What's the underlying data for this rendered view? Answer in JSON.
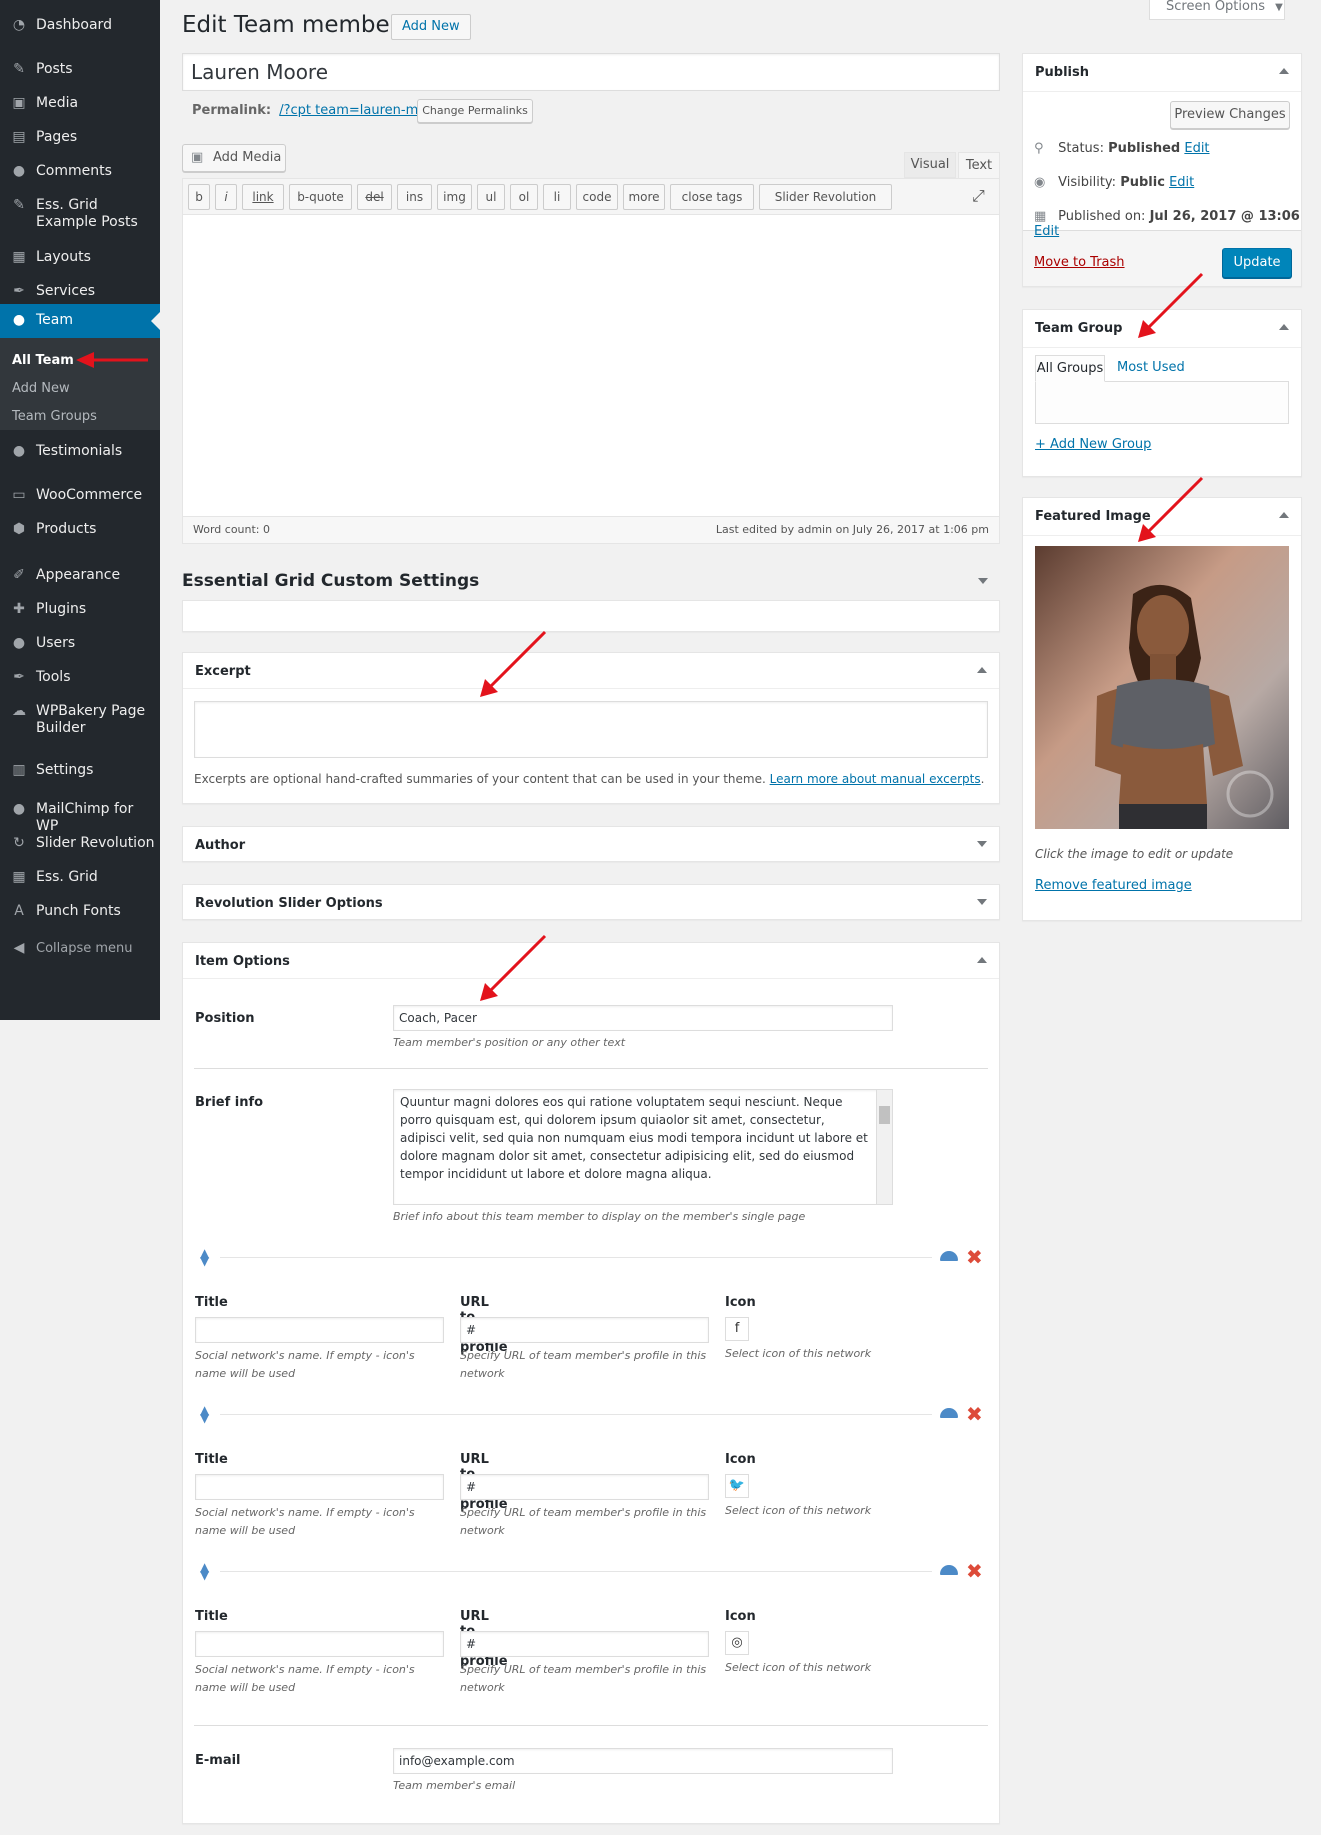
{
  "menu": {
    "items": [
      {
        "label": "Dashboard",
        "icon": "dashboard-icon",
        "glyph": "◔"
      },
      {
        "label": "Posts",
        "icon": "pin-icon",
        "glyph": "✎"
      },
      {
        "label": "Media",
        "icon": "media-icon",
        "glyph": "▣"
      },
      {
        "label": "Pages",
        "icon": "pages-icon",
        "glyph": "▤"
      },
      {
        "label": "Comments",
        "icon": "comments-icon",
        "glyph": "●"
      },
      {
        "label": "Ess. Grid Example Posts",
        "icon": "pin-icon",
        "glyph": "✎"
      },
      {
        "label": "Layouts",
        "icon": "layouts-icon",
        "glyph": "▦"
      },
      {
        "label": "Services",
        "icon": "wrench-icon",
        "glyph": "✒"
      },
      {
        "label": "Team",
        "icon": "user-icon",
        "glyph": "●"
      },
      {
        "label": "Testimonials",
        "icon": "testimonials-icon",
        "glyph": "●"
      },
      {
        "label": "WooCommerce",
        "icon": "woocommerce-icon",
        "glyph": "▭"
      },
      {
        "label": "Products",
        "icon": "products-icon",
        "glyph": "⬢"
      },
      {
        "label": "Appearance",
        "icon": "brush-icon",
        "glyph": "✐"
      },
      {
        "label": "Plugins",
        "icon": "plugin-icon",
        "glyph": "✚"
      },
      {
        "label": "Users",
        "icon": "users-icon",
        "glyph": "●"
      },
      {
        "label": "Tools",
        "icon": "tools-icon",
        "glyph": "✒"
      },
      {
        "label": "WPBakery Page Builder",
        "icon": "wpbakery-icon",
        "glyph": "☁"
      },
      {
        "label": "Settings",
        "icon": "settings-icon",
        "glyph": "▥"
      },
      {
        "label": "MailChimp for WP",
        "icon": "mailchimp-icon",
        "glyph": "●"
      },
      {
        "label": "Slider Revolution",
        "icon": "refresh-icon",
        "glyph": "↻"
      },
      {
        "label": "Ess. Grid",
        "icon": "grid-icon",
        "glyph": "▦"
      },
      {
        "label": "Punch Fonts",
        "icon": "font-icon",
        "glyph": "A"
      }
    ],
    "submenu": [
      "All Team",
      "Add New",
      "Team Groups"
    ],
    "collapse": "Collapse menu"
  },
  "header": {
    "title": "Edit Team member",
    "add_new": "Add New",
    "screen_options": "Screen Options"
  },
  "post": {
    "title": "Lauren Moore",
    "permalink_label": "Permalink:",
    "permalink_url": "/?cpt team=lauren-moore",
    "change_permalinks": "Change Permalinks"
  },
  "editor": {
    "add_media": "Add Media",
    "tab_visual": "Visual",
    "tab_text": "Text",
    "quicktags": [
      "b",
      "i",
      "link",
      "b-quote",
      "del",
      "ins",
      "img",
      "ul",
      "ol",
      "li",
      "code",
      "more",
      "close tags",
      "Slider Revolution"
    ],
    "word_count": "Word count: 0",
    "last_edited": "Last edited by admin on July 26, 2017 at 1:06 pm"
  },
  "ess_grid": {
    "title": "Essential Grid Custom Settings"
  },
  "excerpt": {
    "title": "Excerpt",
    "help": "Excerpts are optional hand-crafted summaries of your content that can be used in your theme.",
    "learn_more": "Learn more about manual excerpts",
    "period": "."
  },
  "author": {
    "title": "Author"
  },
  "rev_slider": {
    "title": "Revolution Slider Options"
  },
  "item_options": {
    "title": "Item Options",
    "position_label": "Position",
    "position_value": "Coach, Pacer",
    "position_desc": "Team member's position or any other text",
    "brief_label": "Brief info",
    "brief_value": "Quuntur magni dolores eos qui ratione voluptatem sequi nesciunt. Neque porro quisquam est, qui dolorem ipsum quiaolor sit amet, consectetur, adipisci velit, sed quia non numquam eius modi tempora incidunt ut labore et dolore magnam dolor sit amet, consectetur adipisicing elit, sed do eiusmod tempor incididunt ut labore et dolore magna aliqua.",
    "brief_desc": "Brief info about this team member to display on the member's single page",
    "social": [
      {
        "title_label": "Title",
        "title_value": "",
        "url_label": "URL to your profile",
        "url_value": "#",
        "icon_label": "Icon",
        "icon": "facebook-icon",
        "glyph": "f",
        "title_desc": "Social network's name. If empty - icon's name will be used",
        "url_desc": "Specify URL of team member's profile in this network",
        "icon_desc": "Select icon of this network"
      },
      {
        "title_label": "Title",
        "title_value": "",
        "url_label": "URL to your profile",
        "url_value": "#",
        "icon_label": "Icon",
        "icon": "twitter-icon",
        "glyph": "🐦",
        "title_desc": "Social network's name. If empty - icon's name will be used",
        "url_desc": "Specify URL of team member's profile in this network",
        "icon_desc": "Select icon of this network"
      },
      {
        "title_label": "Title",
        "title_value": "",
        "url_label": "URL to your profile",
        "url_value": "#",
        "icon_label": "Icon",
        "icon": "instagram-icon",
        "glyph": "◎",
        "title_desc": "Social network's name. If empty - icon's name will be used",
        "url_desc": "Specify URL of team member's profile in this network",
        "icon_desc": "Select icon of this network"
      }
    ],
    "email_label": "E-mail",
    "email_value": "info@example.com",
    "email_desc": "Team member's email"
  },
  "publish": {
    "title": "Publish",
    "preview": "Preview Changes",
    "status_label": "Status:",
    "status_value": "Published",
    "visibility_label": "Visibility:",
    "visibility_value": "Public",
    "published_label": "Published on:",
    "published_value": "Jul 26, 2017 @ 13:06",
    "edit": "Edit",
    "trash": "Move to Trash",
    "update": "Update"
  },
  "team_group": {
    "title": "Team Group",
    "tab_all": "All Groups",
    "tab_used": "Most Used",
    "add_new": "+ Add New Group"
  },
  "featured": {
    "title": "Featured Image",
    "hint": "Click the image to edit or update",
    "remove": "Remove featured image"
  },
  "colors": {
    "accent": "#0073aa",
    "menu_bg": "#23282d",
    "annotation": "#e3131c"
  }
}
